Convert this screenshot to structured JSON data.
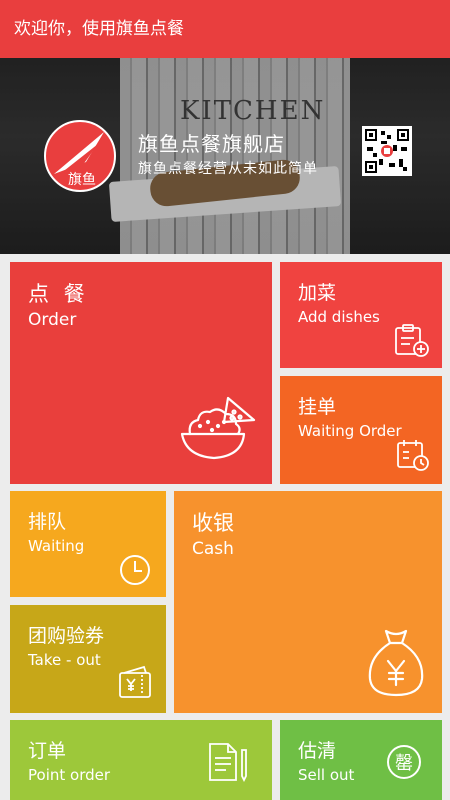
{
  "header": {
    "title": "欢迎你，使用旗鱼点餐"
  },
  "banner": {
    "apron_text": "KITCHEN",
    "brand_title": "旗鱼点餐旗舰店",
    "slogan": "旗鱼点餐经营从未如此简单",
    "logo_text": "旗鱼"
  },
  "tiles": {
    "order": {
      "zh": "点 餐",
      "en": "Order",
      "icon": "food-bowl-icon",
      "color": "#e93f3c"
    },
    "add_dishes": {
      "zh": "加菜",
      "en": "Add dishes",
      "icon": "clipboard-add-icon",
      "color": "#f04340"
    },
    "waiting_order": {
      "zh": "挂单",
      "en": "Waiting Order",
      "icon": "calendar-clock-icon",
      "color": "#f36523"
    },
    "queue": {
      "zh": "排队",
      "en": "Waiting",
      "icon": "clock-icon",
      "color": "#f6a81e"
    },
    "cash": {
      "zh": "收银",
      "en": "Cash",
      "icon": "money-bag-icon",
      "color": "#f7922d"
    },
    "group_buy": {
      "zh": "团购验券",
      "en": "Take - out",
      "icon": "coupon-wallet-icon",
      "color": "#c7a718"
    },
    "point_order": {
      "zh": "订单",
      "en": "Point order",
      "icon": "document-pen-icon",
      "color": "#9dc83a"
    },
    "sell_out": {
      "zh": "估清",
      "en": "Sell out",
      "icon": "sellout-badge-icon",
      "badge": "罄",
      "color": "#6fbf45"
    }
  }
}
